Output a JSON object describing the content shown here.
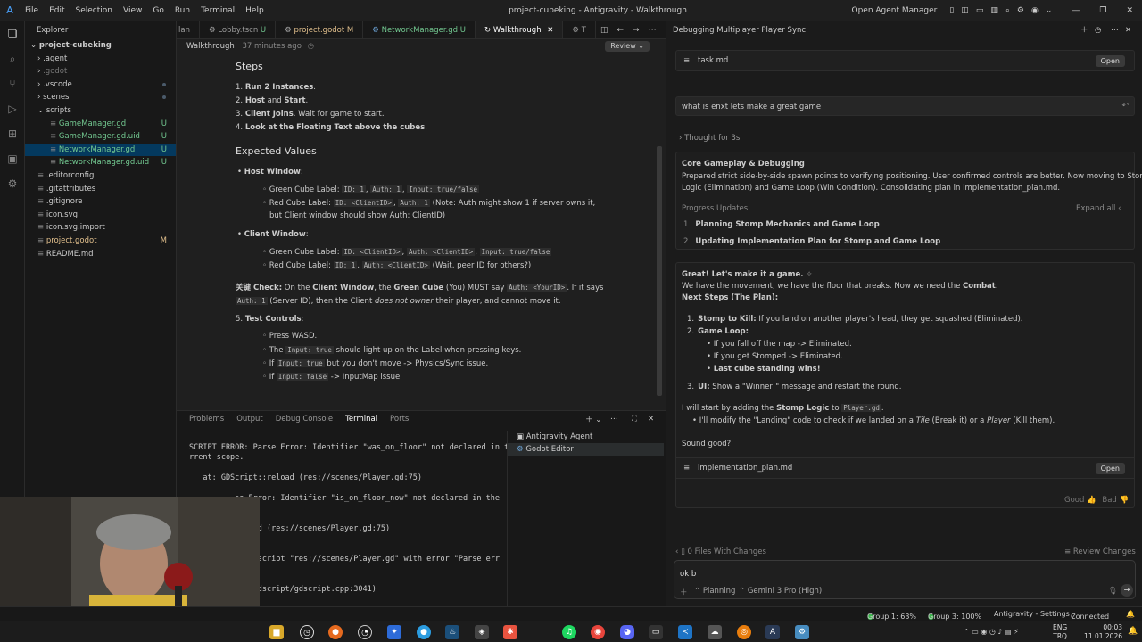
{
  "window": {
    "title": "project-cubeking - Antigravity - Walkthrough",
    "open_agent_manager": "Open Agent Manager"
  },
  "menu": [
    "File",
    "Edit",
    "Selection",
    "View",
    "Go",
    "Run",
    "Terminal",
    "Help"
  ],
  "explorer": {
    "header": "Explorer",
    "project": "project-cubeking",
    "items": [
      {
        "label": ".agent",
        "indent": 1,
        "type": "folder"
      },
      {
        "label": ".godot",
        "indent": 1,
        "type": "folder",
        "dim": true
      },
      {
        "label": ".vscode",
        "indent": 1,
        "type": "folder"
      },
      {
        "label": "scenes",
        "indent": 1,
        "type": "folder"
      },
      {
        "label": "scripts",
        "indent": 1,
        "type": "folder",
        "open": true
      },
      {
        "label": "GameManager.gd",
        "indent": 2,
        "badge": "U",
        "color": "#73c991"
      },
      {
        "label": "GameManager.gd.uid",
        "indent": 2,
        "badge": "U",
        "color": "#73c991"
      },
      {
        "label": "NetworkManager.gd",
        "indent": 2,
        "badge": "U",
        "color": "#73c991",
        "selected": true
      },
      {
        "label": "NetworkManager.gd.uid",
        "indent": 2,
        "badge": "U",
        "color": "#73c991"
      },
      {
        "label": ".editorconfig",
        "indent": 1
      },
      {
        "label": ".gitattributes",
        "indent": 1
      },
      {
        "label": ".gitignore",
        "indent": 1
      },
      {
        "label": "icon.svg",
        "indent": 1
      },
      {
        "label": "icon.svg.import",
        "indent": 1
      },
      {
        "label": "project.godot",
        "indent": 1,
        "badge": "M",
        "color": "#e2c08d"
      },
      {
        "label": "README.md",
        "indent": 1
      }
    ]
  },
  "tabs": [
    {
      "label": "lan"
    },
    {
      "label": "Lobby.tscn",
      "badge": "U"
    },
    {
      "label": "project.godot",
      "badge": "M"
    },
    {
      "label": "NetworkManager.gd",
      "badge": "U"
    },
    {
      "label": "Walkthrough",
      "active": true
    },
    {
      "label": "T"
    }
  ],
  "breadcrumb": {
    "label": "Walkthrough",
    "time": "37 minutes ago",
    "review": "Review"
  },
  "doc": {
    "steps_title": "Steps",
    "steps": [
      {
        "n": "1.",
        "b": "Run 2 Instances",
        "t": "."
      },
      {
        "n": "2.",
        "b": "Host",
        "m": " and ",
        "b2": "Start",
        "t": "."
      },
      {
        "n": "3.",
        "b": "Client Joins",
        "t": ". Wait for game to start."
      },
      {
        "n": "4.",
        "b": "Look at the Floating Text above the cubes",
        "t": "."
      }
    ],
    "expected_title": "Expected Values",
    "host_window": "Host Window",
    "host_green_label": "Green Cube Label:",
    "host_green_codes": [
      "ID: 1",
      ",",
      "Auth: 1",
      ",",
      "Input: true/false"
    ],
    "host_red_label": "Red Cube Label:",
    "host_red_codes": [
      "ID: <ClientID>",
      ",",
      "Auth: 1"
    ],
    "host_red_note1": "(Note: Auth might show 1 if server owns it,",
    "host_red_note2": "but Client window should show Auth: ClientID)",
    "client_window": "Client Window",
    "client_green_label": "Green Cube Label:",
    "client_green_codes": [
      "ID: <ClientID>",
      ",",
      "Auth: <ClientID>",
      ",",
      "Input: true/false"
    ],
    "client_red_label": "Red Cube Label:",
    "client_red_codes": [
      "ID: 1",
      ",",
      "Auth: <ClientID>"
    ],
    "client_red_note": "(Wait, peer ID for others?)",
    "check_prefix": "关键 Check:",
    "check_text1": " On the ",
    "check_b1": "Client Window",
    "check_text2": ", the ",
    "check_b2": "Green Cube",
    "check_text3": " (You) MUST say ",
    "check_code1": "Auth: <YourID>",
    "check_text4": ". If it says",
    "check_code2": "Auth: 1",
    "check_text5": " (Server ID), then the Client ",
    "check_em": "does not owner",
    "check_text6": " their player, and cannot move it.",
    "test_n": "5.",
    "test_title": "Test Controls",
    "t1": "Press WASD.",
    "t2a": "The ",
    "t2c": "Input: true",
    "t2b": " should light up on the Label when pressing keys.",
    "t3a": "If ",
    "t3c": "Input: true",
    "t3b": " but you don't move -> Physics/Sync issue.",
    "t4a": "If ",
    "t4c": "Input: false",
    "t4b": " -> InputMap issue."
  },
  "panel": {
    "tabs": [
      "Problems",
      "Output",
      "Debug Console",
      "Terminal",
      "Ports"
    ],
    "active": "Terminal",
    "term_lines": [
      "SCRIPT ERROR: Parse Error: Identifier \"was_on_floor\" not declared in the cu",
      "rrent scope.",
      "",
      "   at: GDScript::reload (res://scenes/Player.gd:75)",
      "",
      "          se Error: Identifier \"is_on_floor_now\" not declared in the",
      "",
      "",
      "          reload (res://scenes/Player.gd:75)",
      "",
      "",
      "          load script \"res://scenes/Player.gd\" with error \"Parse err",
      "",
      "",
      "          les/gdscript/gdscript.cpp:3041)"
    ],
    "terminals": [
      "Antigravity Agent",
      "Godot Editor"
    ]
  },
  "chat": {
    "title": "Debugging Multiplayer Player Sync",
    "task_file": "task.md",
    "open_label": "Open",
    "user_msg": "what is enxt lets make a great game",
    "thought": "Thought for 3s",
    "section_title": "Core Gameplay & Debugging",
    "section_text1": "Prepared strict side-by-side spawn points to verifying positioning. User confirmed controls are better. Now moving to Stomp",
    "section_text2": "Logic (Elimination) and Game Loop (Win Condition). Consolidating plan in implementation_plan.md.",
    "progress_label": "Progress Updates",
    "expand_all": "Expand all",
    "progress": [
      {
        "n": "1",
        "t": "Planning Stomp Mechanics and Game Loop"
      },
      {
        "n": "2",
        "t": "Updating Implementation Plan for Stomp and Game Loop"
      }
    ],
    "reply_title": "Great! Let's make it a game.",
    "reply_l1a": "We have the movement, we have the floor that breaks. Now we need the ",
    "reply_l1b": "Combat",
    "reply_l1c": ".",
    "next_steps": "Next Steps (The Plan):",
    "s1n": "1.",
    "s1b": "Stomp to Kill:",
    "s1t": " If you land on another player's head, they get squashed (Eliminated).",
    "s2n": "2.",
    "s2b": "Game Loop:",
    "s2a": "If you fall off the map -> Eliminated.",
    "s2c": "If you get Stomped -> Eliminated.",
    "s2d": "Last cube standing wins!",
    "s3n": "3.",
    "s3b": "UI:",
    "s3t": " Show a \"Winner!\" message and restart the round.",
    "start_a": "I will start by adding the ",
    "start_b": "Stomp Logic",
    "start_c": " to ",
    "start_code": "Player.gd",
    "start_d": ".",
    "modify_a": "I'll modify the \"Landing\" code to check if we landed on a ",
    "modify_tile": "Tile",
    "modify_b": " (Break it) or a ",
    "modify_player": "Player",
    "modify_c": " (Kill them).",
    "sound_good": "Sound good?",
    "plan_file": "implementation_plan.md",
    "good": "Good",
    "bad": "Bad",
    "files_changes": "0 Files With Changes",
    "review_changes": "Review Changes",
    "input_value": "ok b",
    "mode": "Planning",
    "model": "Gemini 3 Pro (High)"
  },
  "status": {
    "group1": "Group 1: 63%",
    "group3": "Group 3: 100%",
    "settings": "Antigravity - Settings",
    "connected": "Connected"
  },
  "taskbar": {
    "lang1": "ENG",
    "lang2": "TRQ",
    "time": "00:03",
    "date": "11.01.2026"
  },
  "colors": {
    "accent": "#0078d4",
    "selected": "#04395e",
    "untracked": "#73c991",
    "modified": "#e2c08d"
  }
}
